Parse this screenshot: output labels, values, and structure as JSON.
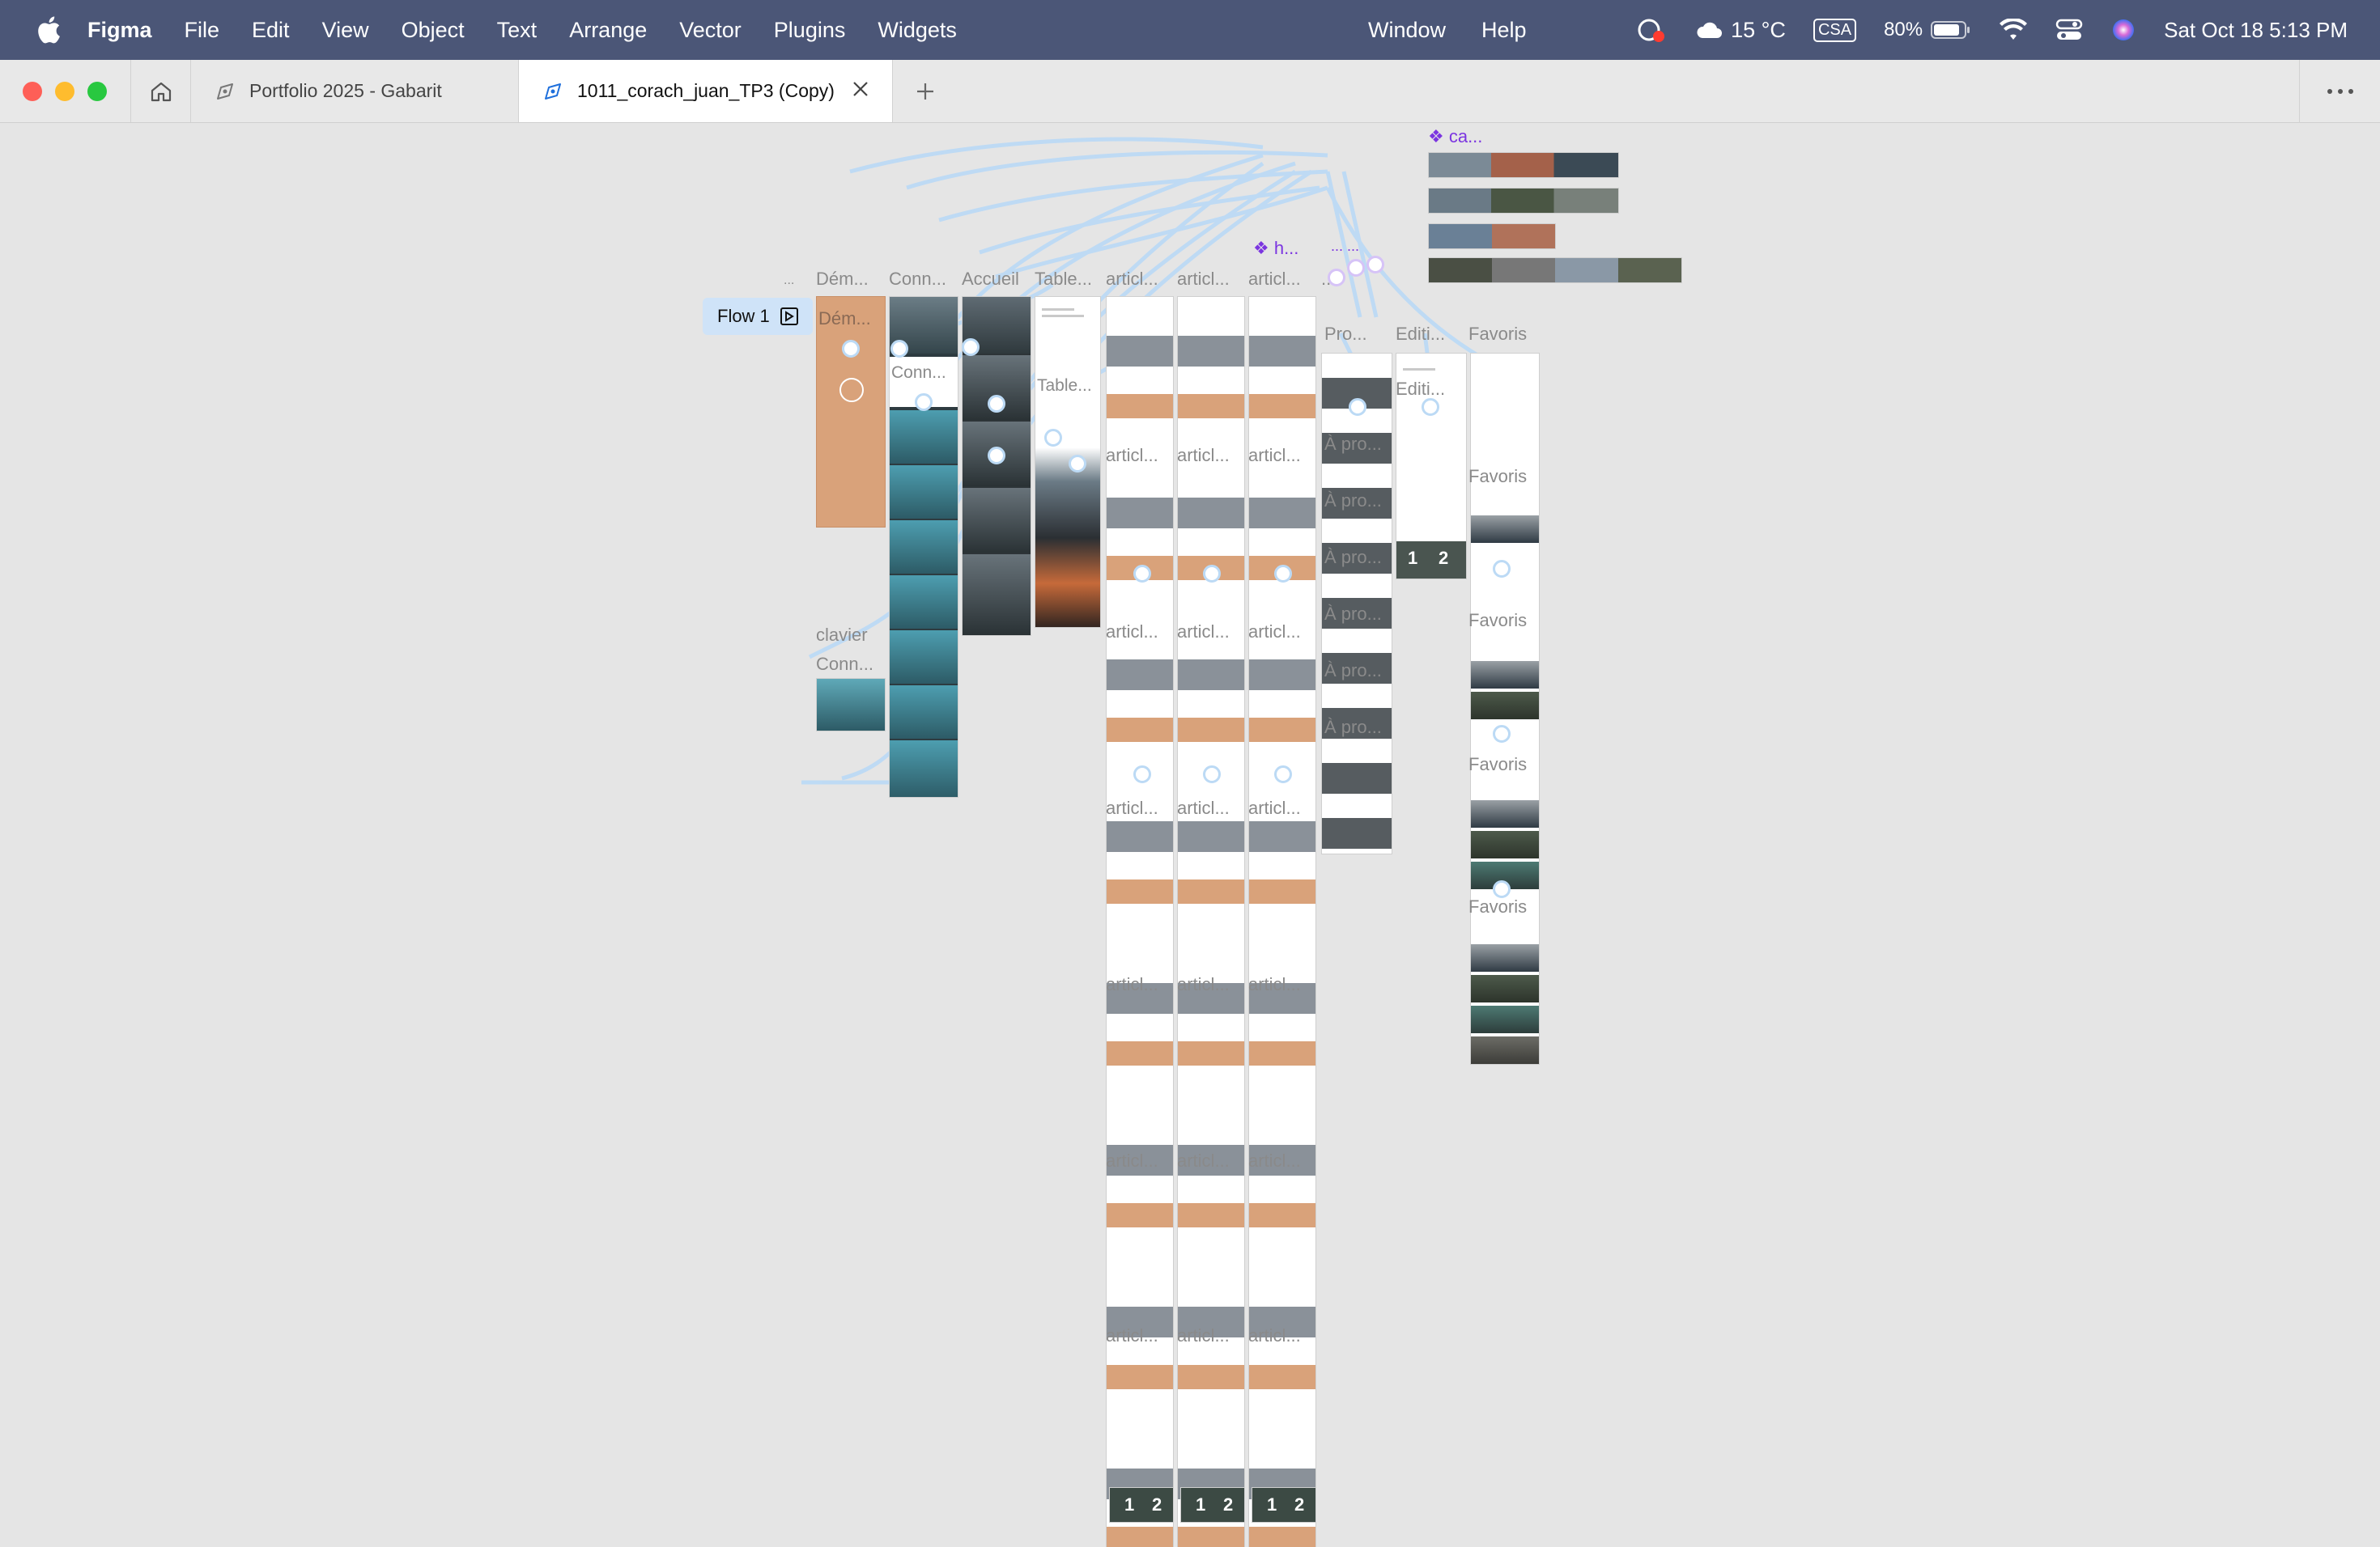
{
  "menubar": {
    "app": "Figma",
    "items": [
      "File",
      "Edit",
      "View",
      "Object",
      "Text",
      "Arrange",
      "Vector",
      "Plugins",
      "Widgets"
    ],
    "right_items": [
      "Window",
      "Help"
    ],
    "weather": "15 °C",
    "input_source": "CSA",
    "battery": "80%",
    "datetime": "Sat Oct 18  5:13 PM"
  },
  "tabs": {
    "inactive": "Portfolio 2025 - Gabarit",
    "active": "1011_corach_juan_TP3 (Copy)"
  },
  "canvas": {
    "flow_label": "Flow 1",
    "ellipsis_small": "...",
    "col_titles": [
      "Dém...",
      "Conn...",
      "Accueil",
      "Table...",
      "articl...",
      "articl...",
      "articl...",
      "..."
    ],
    "inner_labels": {
      "dem": "Dém...",
      "conn_repeat": "Conn...",
      "table": "Table...",
      "clavier": "clavier",
      "conn_bottom": "Conn...",
      "pro": "Pro...",
      "edit": "Editi...",
      "edit2": "Editi...",
      "apro": "À pro...",
      "favoris": "Favoris",
      "articl": "articl...",
      "pagination_1": "1",
      "pagination_2": "2"
    },
    "components": {
      "h": "❖ h...",
      "h_dots": "... ...",
      "ca": "❖ ca...",
      "row2": "❖ ca...",
      "row3": "❖ ca..."
    }
  }
}
